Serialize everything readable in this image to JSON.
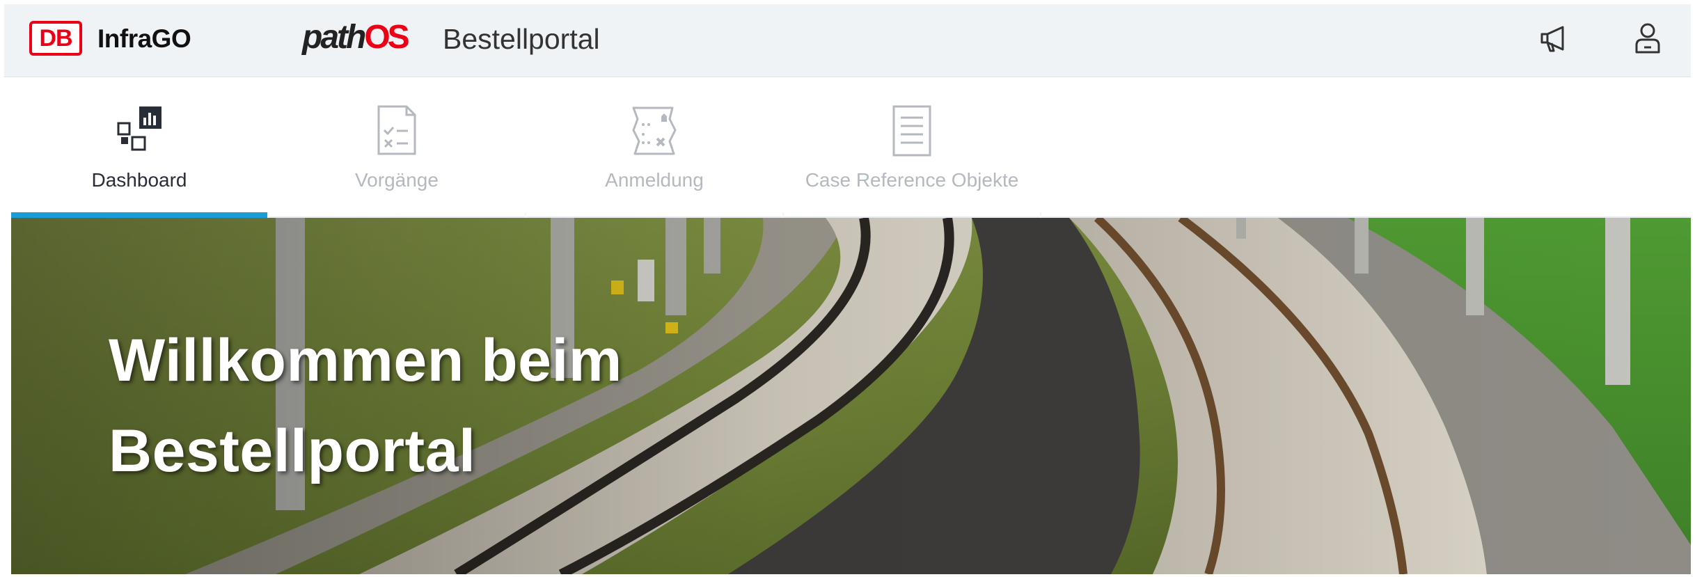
{
  "header": {
    "db_logo": "DB",
    "brand": "InfraGO",
    "app_logo_part1": "path",
    "app_logo_part2": "OS",
    "title": "Bestellportal",
    "icons": [
      "megaphone-icon",
      "user-icon"
    ]
  },
  "tabs": [
    {
      "label": "Dashboard",
      "icon": "dashboard-icon",
      "active": true
    },
    {
      "label": "Vorgänge",
      "icon": "checklist-icon",
      "active": false
    },
    {
      "label": "Anmeldung",
      "icon": "registration-icon",
      "active": false
    },
    {
      "label": "Case Reference Objekte",
      "icon": "document-list-icon",
      "active": false
    }
  ],
  "hero": {
    "line1": "Willkommen beim",
    "line2": "Bestellportal"
  },
  "colors": {
    "db_red": "#ec0016",
    "active_tab": "#1a9bd8",
    "header_bg": "#f0f3f5"
  }
}
